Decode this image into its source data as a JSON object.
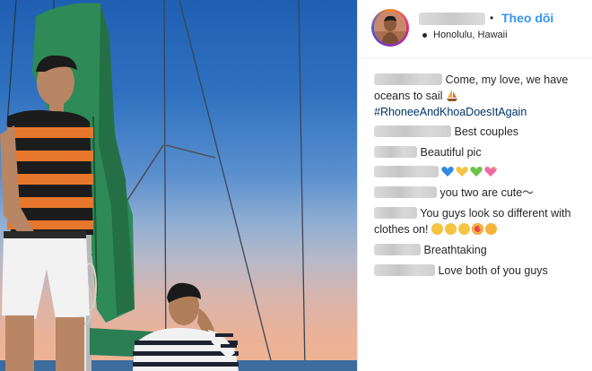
{
  "header": {
    "username": "nhandanh",
    "follow_separator": "•",
    "follow_label": "Theo dõi",
    "location": "Honolulu, Hawaii"
  },
  "caption": {
    "author": "nhandanh",
    "text_line1": "Come, my love, we have",
    "text_line2": "oceans to sail",
    "emoji": "sailboat-emoji",
    "hashtag": "#RhoneeAndKhoaDoesItAgain"
  },
  "comments": [
    {
      "author": "user1",
      "text": "Best couples"
    },
    {
      "author": "user2",
      "text": "Beautiful pic"
    },
    {
      "author": "user3",
      "text": "",
      "emojis": [
        "blue-heart",
        "yellow-heart",
        "green-heart",
        "sparkling-heart"
      ]
    },
    {
      "author": "user4",
      "text": "you two are cute～"
    },
    {
      "author": "user5",
      "text_line1": "You guys look so different with",
      "text_line2": "clothes on!",
      "emojis": [
        "grinning-face",
        "grinning-face",
        "grinning-face",
        "heart-eyes-face",
        "kissing-face"
      ]
    },
    {
      "author": "user6",
      "text": "Breathtaking"
    },
    {
      "author": "user7",
      "text": "Love both of you guys"
    }
  ],
  "colors": {
    "follow": "#3897f0",
    "hashtag": "#003569",
    "text": "#262626",
    "sail": "#2e8a57"
  }
}
